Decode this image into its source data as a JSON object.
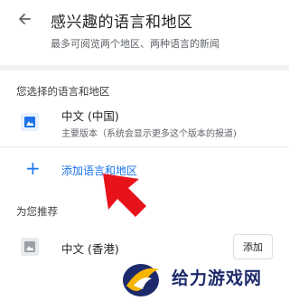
{
  "header": {
    "title": "感兴趣的语言和地区",
    "subtitle": "最多可阅览两个地区、两种语言的新闻"
  },
  "selected_section": {
    "label": "您选择的语言和地区",
    "items": [
      {
        "name": "中文 (中国)",
        "desc": "主要版本（系统会显示更多这个版本的报道)"
      }
    ]
  },
  "add_action": {
    "label": "添加语言和地区"
  },
  "recommend_section": {
    "label": "为您推荐",
    "items": [
      {
        "name": "中文 (香港)",
        "button": "添加"
      }
    ]
  },
  "watermark": {
    "text": "给力游戏网"
  },
  "colors": {
    "accent": "#1a73e8",
    "arrow": "#e8121b",
    "icon_blue": "#1a73e8",
    "icon_grey": "#9aa0a6"
  },
  "icons": {
    "back": "back-arrow-icon",
    "plus": "plus-icon",
    "language": "language-icon"
  }
}
